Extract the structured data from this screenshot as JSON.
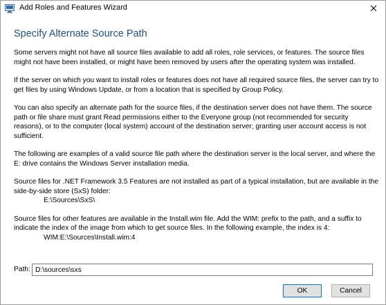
{
  "window": {
    "title": "Add Roles and Features Wizard",
    "app_icon": "server-manager-icon",
    "close_icon": "close-icon"
  },
  "heading": "Specify Alternate Source Path",
  "paragraphs": [
    "Some servers might not have all source files available to add all roles, role services, or features. The source files might not have been installed, or might have been removed by users after the operating system was installed.",
    "If the server on which you want to install roles or features does not have all required source files, the server can try to get files by using Windows Update, or from a location that is specified by Group Policy.",
    "You can also specify an alternate path for the source files, if the destination server does not have them. The source path or file share must grant Read permissions either to the Everyone group (not recommended for security reasons), or to the computer (local system) account of the destination server; granting user account access is not sufficient.",
    "The following are examples of a valid source file path where the destination server is the local server, and where the E: drive contains the Windows Server installation media."
  ],
  "example_sxs": {
    "text": "Source files for .NET Framework 3.5 Features are not installed as part of a typical installation, but are available in the side-by-side store (SxS) folder:",
    "path": "E:\\Sources\\SxS\\"
  },
  "example_wim": {
    "text": "Source files for other features are available in the Install.wim file. Add the WIM: prefix to the path, and a suffix to indicate the index of the image from which to get source files. In the following example, the index is 4:",
    "path": "WIM:E:\\Sources\\Install.wim:4"
  },
  "path_field": {
    "label": "Path:",
    "value": "D:\\sources\\sxs"
  },
  "buttons": {
    "ok": "OK",
    "cancel": "Cancel"
  }
}
